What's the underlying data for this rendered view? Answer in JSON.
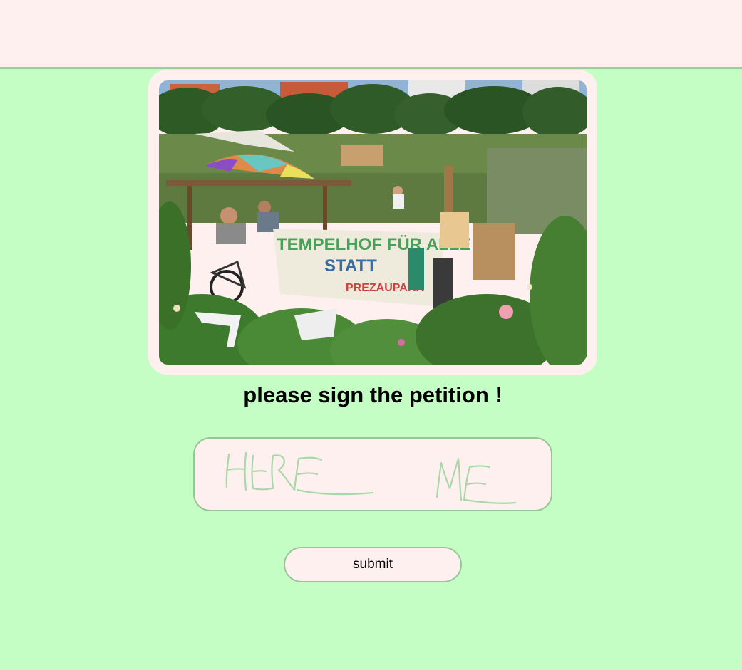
{
  "header": {},
  "hero_image": {
    "alt_subject": "community garden protest",
    "banner_text": [
      "TEMPELHOF FÜR ALLE",
      "STATT",
      "PREZAUPARK"
    ]
  },
  "heading": "please sign the petition !",
  "signature": {
    "handwritten_text": "HERE ME",
    "stroke_color": "#a8d8a8"
  },
  "submit_label": "submit",
  "colors": {
    "background": "#c4fec4",
    "panel": "#fff0f0",
    "border": "#98c498"
  }
}
